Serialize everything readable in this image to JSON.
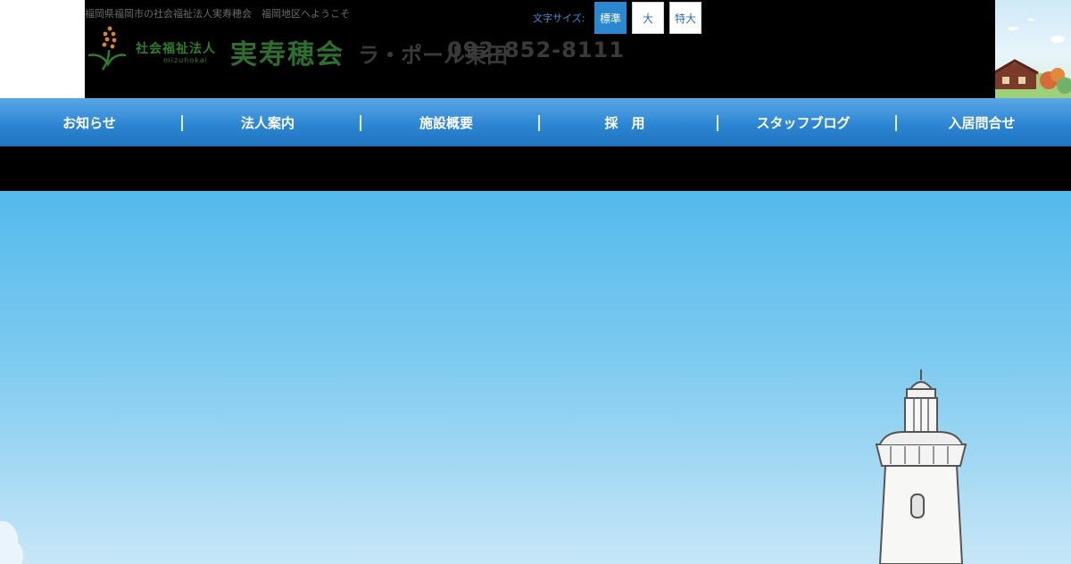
{
  "header": {
    "tagline": "福岡県福岡市の社会福祉法人実寿穂会　福岡地区へようこそ",
    "logo": {
      "small": "社会福祉法人",
      "roman": "mizuhokai",
      "main": "実寿穂会"
    },
    "facility_name": "ラ・ポール東田",
    "phone": "092-852-8111",
    "font_size": {
      "label": "文字サイズ:",
      "options": [
        "標準",
        "大",
        "特大"
      ],
      "selected": "標準"
    }
  },
  "nav": {
    "items": [
      "お知らせ",
      "法人案内",
      "施設概要",
      "採　用",
      "スタッフブログ",
      "入居問合せ"
    ]
  },
  "colors": {
    "nav_blue": "#2d86d3",
    "accent_green": "#2e7d2e",
    "sky": "#7dcaf0"
  }
}
